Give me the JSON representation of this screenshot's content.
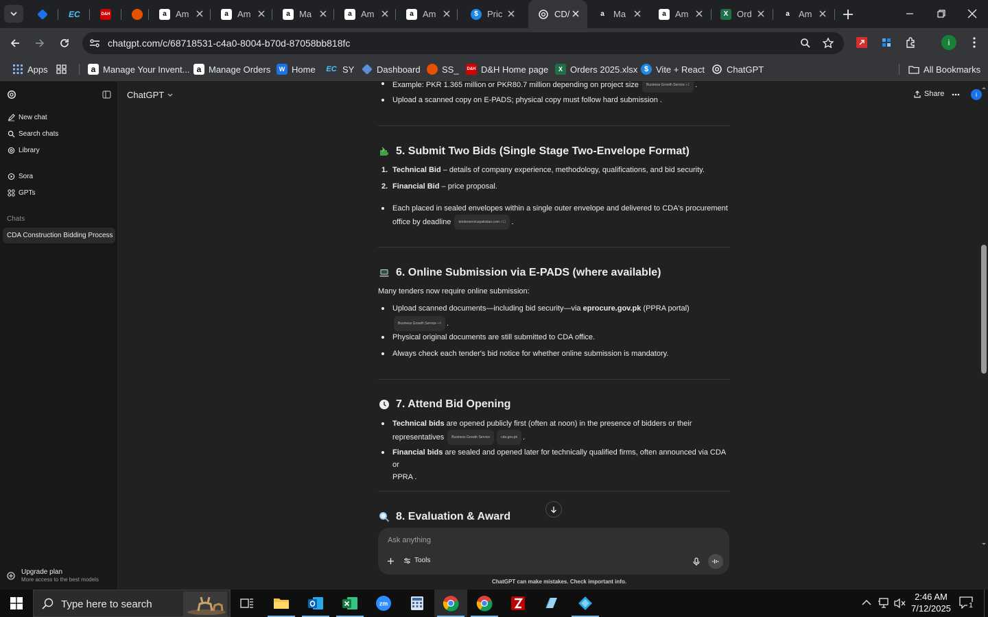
{
  "browser": {
    "tabs": [
      {
        "title": "",
        "icon": "diamond-icon",
        "color": "#1a73e8"
      },
      {
        "title": "",
        "icon": "ec-icon",
        "color": "#1565c0"
      },
      {
        "title": "",
        "icon": "dh-icon",
        "color": "#d50000"
      },
      {
        "title": "",
        "icon": "stack-icon",
        "color": "#e65100"
      },
      {
        "title": "Am",
        "icon": "amazon-icon",
        "color": "#ffffff"
      },
      {
        "title": "Am",
        "icon": "amazon-icon",
        "color": "#ffffff"
      },
      {
        "title": "Ma",
        "icon": "amazon-icon",
        "color": "#ffffff"
      },
      {
        "title": "Am",
        "icon": "amazon-icon",
        "color": "#ffffff"
      },
      {
        "title": "Am",
        "icon": "amazon-icon",
        "color": "#ffffff"
      },
      {
        "title": "Pric",
        "icon": "dollar-icon",
        "color": "#1e88e5"
      },
      {
        "title": "CD/",
        "icon": "openai-icon",
        "color": "#ffffff"
      },
      {
        "title": "Ma",
        "icon": "amazon-icon",
        "color": "#ffffff"
      },
      {
        "title": "Am",
        "icon": "amazon-icon",
        "color": "#ffffff"
      },
      {
        "title": "Ord",
        "icon": "excel-icon",
        "color": "#1e7145"
      },
      {
        "title": "Am",
        "icon": "amazon-icon",
        "color": "#ffffff"
      }
    ],
    "url": "chatgpt.com/c/68718531-c4a0-8004-b70d-87058bb818fc",
    "bookmarks": [
      {
        "label": "Apps",
        "icon": "apps-grid-icon"
      },
      {
        "label": "",
        "icon": "tab-groups-icon"
      },
      {
        "label": "Manage Your Invent...",
        "icon": "amazon-icon"
      },
      {
        "label": "Manage Orders",
        "icon": "amazon-icon"
      },
      {
        "label": "Home",
        "icon": "wix-icon"
      },
      {
        "label": "SY",
        "icon": "ec-icon"
      },
      {
        "label": "Dashboard",
        "icon": "diamond-icon"
      },
      {
        "label": "SS_",
        "icon": "stack-icon"
      },
      {
        "label": "D&H Home page",
        "icon": "dh-icon"
      },
      {
        "label": "Orders 2025.xlsx",
        "icon": "excel-icon"
      },
      {
        "label": "Vite + React",
        "icon": "dollar-icon"
      },
      {
        "label": "ChatGPT",
        "icon": "openai-icon"
      }
    ],
    "all_bookmarks": "All Bookmarks",
    "profile_initial": "i"
  },
  "sidebar": {
    "new_chat": "New chat",
    "search_chats": "Search chats",
    "library": "Library",
    "sora": "Sora",
    "gpts": "GPTs",
    "chats_heading": "Chats",
    "active_chat": "CDA Construction Bidding Process",
    "upgrade_title": "Upgrade plan",
    "upgrade_sub": "More access to the best models"
  },
  "header": {
    "model": "ChatGPT",
    "share": "Share",
    "avatar": "i"
  },
  "message": {
    "top_partial": "Example: PKR 1.365 million or PKR80.7 million depending on project size",
    "top_partial_pill": "Business Growth Service",
    "top_bullet": "Upload a scanned copy on E-PADS; physical copy must follow hard submission .",
    "s5": {
      "title": "5. Submit Two Bids (Single Stage Two-Envelope Format)",
      "n1_bold": "Technical Bid",
      "n1_rest": " – details of company experience, methodology, qualifications, and bid security.",
      "n2_bold": "Financial Bid",
      "n2_rest": " – price proposal.",
      "b1_line1": "Each placed in sealed envelopes within a single outer envelope and delivered to CDA's procurement",
      "b1_line2": "office by deadline",
      "b1_pill": "tenderservicepakistan.com",
      "b1_pill_more": "+11"
    },
    "s6": {
      "title": "6. Online Submission via E-PADS (where available)",
      "intro": "Many tenders now require online submission:",
      "b1_pre": "Upload scanned documents—including bid security—via ",
      "b1_bold": "eprocure.gov.pk",
      "b1_post": " (PPRA portal)",
      "b1_pill": "Business Growth Service",
      "b1_pill_more": "+4",
      "b2": "Physical original documents are still submitted to CDA office.",
      "b3": "Always check each tender's bid notice for whether online submission is mandatory."
    },
    "s7": {
      "title": "7. Attend Bid Opening",
      "b1_bold": "Technical bids",
      "b1_rest": " are opened publicly first (often at noon) in the presence of bidders or their",
      "b1_line2": "representatives",
      "b1_pill1": "Business Growth Service",
      "b1_pill2": "cda.gov.pk",
      "b2_bold": "Financial bids",
      "b2_rest": " are sealed and opened later for technically qualified firms, often announced via CDA or",
      "b2_line2": "PPRA ."
    },
    "s8": {
      "title": "8. Evaluation & Award"
    }
  },
  "composer": {
    "placeholder": "Ask anything",
    "tools": "Tools",
    "disclaimer": "ChatGPT can make mistakes. Check important info."
  },
  "taskbar": {
    "search_placeholder": "Type here to search",
    "time": "2:46 AM",
    "date": "7/12/2025",
    "notification_count": "1",
    "apps": [
      "task-view-icon",
      "file-explorer-icon",
      "outlook-icon",
      "excel-icon",
      "zoom-icon",
      "calculator-icon",
      "chrome-icon",
      "chrome-icon",
      "filezilla-icon",
      "notes-icon",
      "diamond-icon"
    ]
  },
  "colors": {
    "accent_blue": "#1a73e8",
    "chat_bg": "#212121",
    "sidebar_bg": "#181818"
  }
}
